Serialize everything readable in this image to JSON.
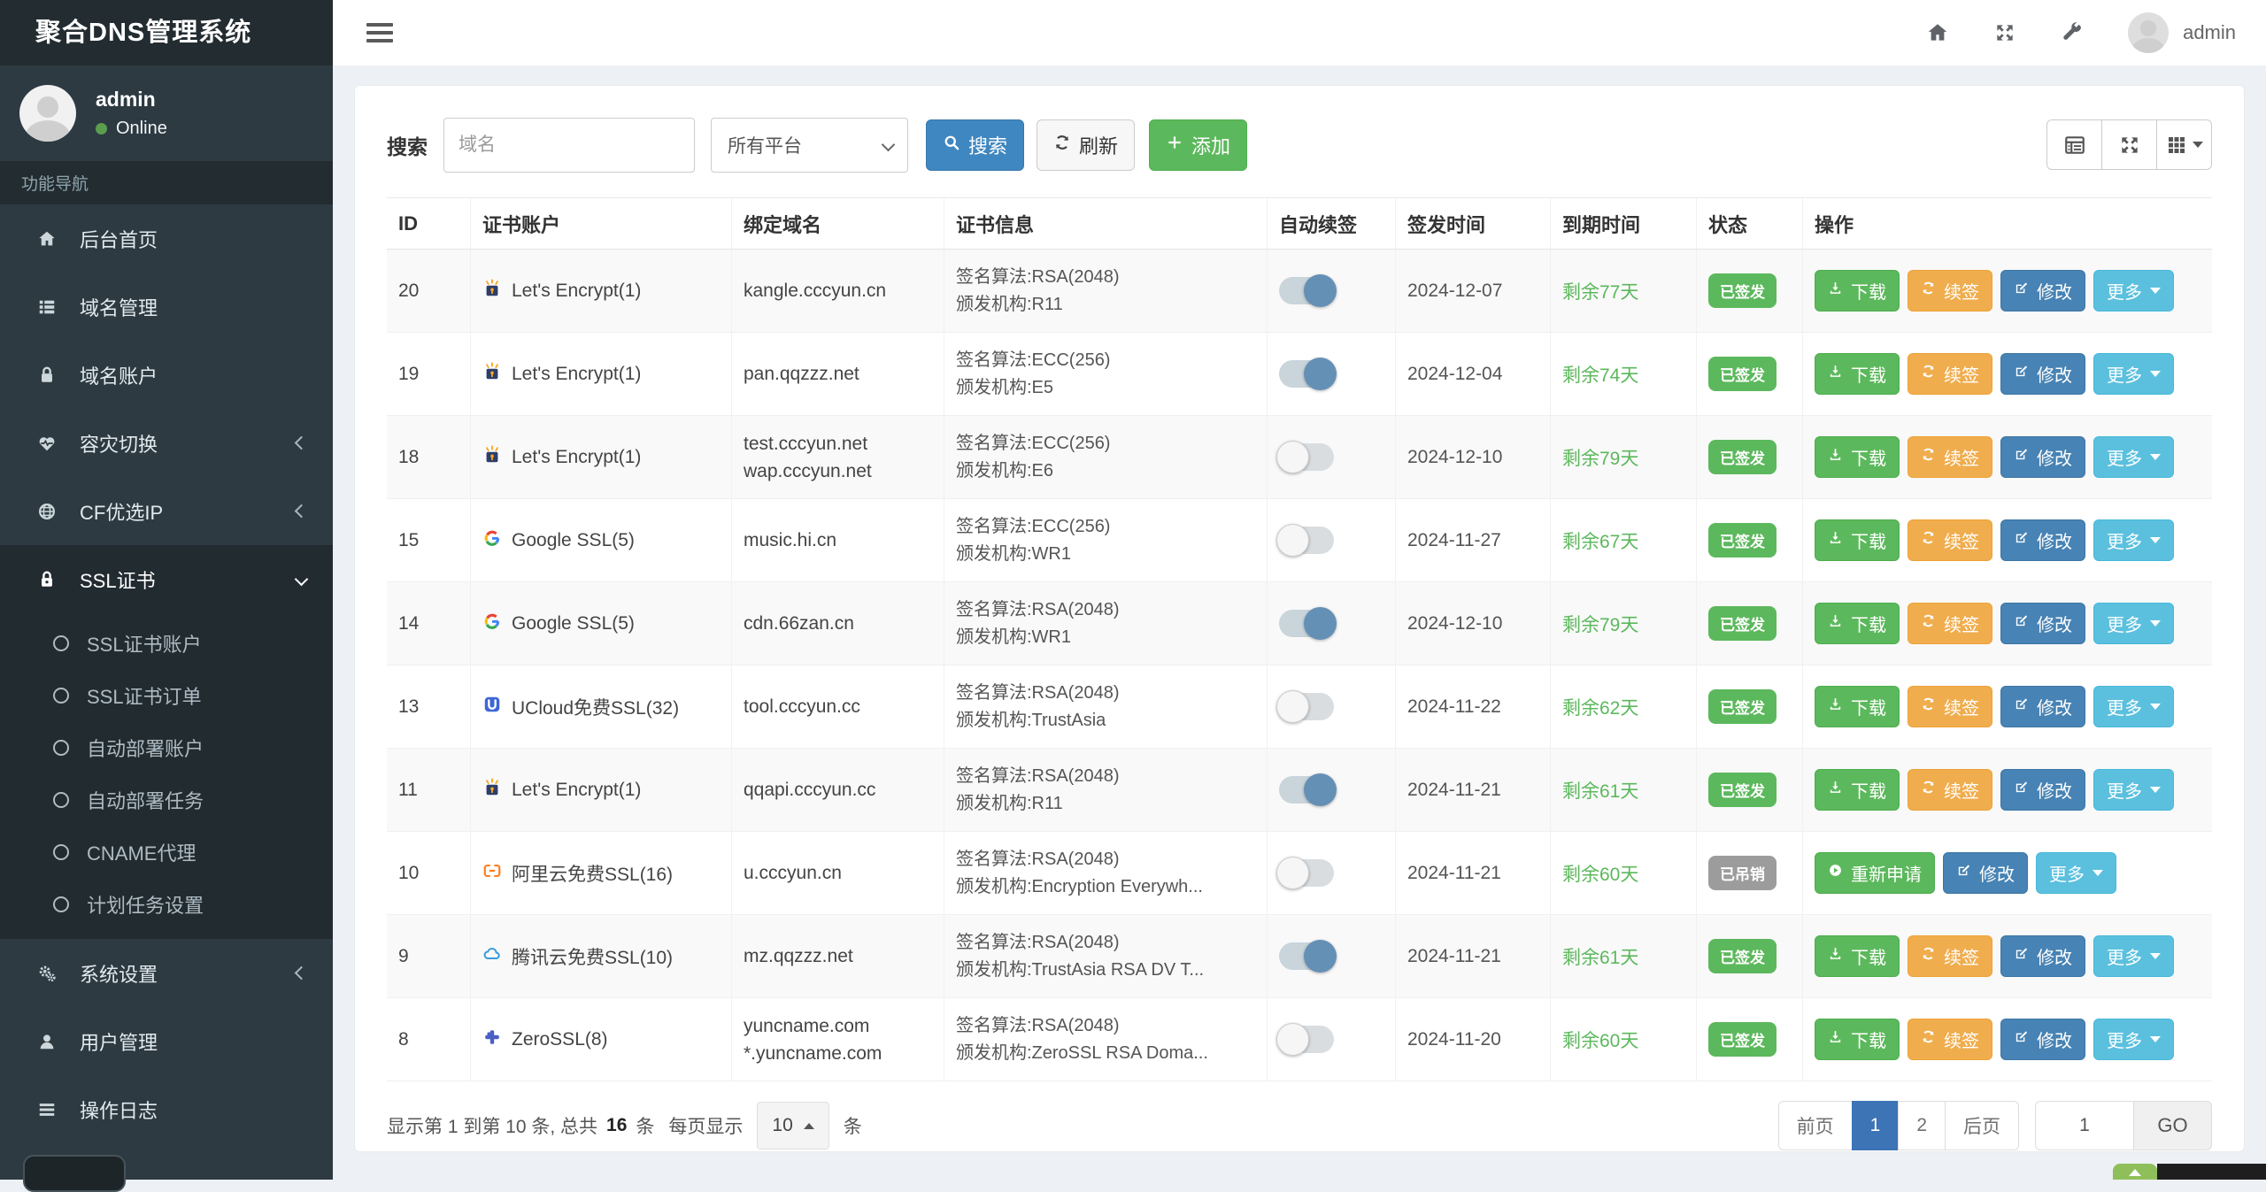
{
  "app": {
    "title": "聚合DNS管理系统"
  },
  "topbar": {
    "user": "admin",
    "icons": [
      "home-icon",
      "expand-icon",
      "wrench-icon"
    ]
  },
  "colors": {
    "primary": "#3f87c0",
    "edit_blue": "#4783b4",
    "success": "#5cb85c",
    "warning": "#f0ad4e",
    "info": "#5bc0de",
    "muted_badge": "#9c9c9c",
    "days_left_green": "#5cb85c",
    "sidebar_bg": "#2d3a42",
    "sidebar_dark": "#232c31",
    "content_bg": "#edf0f4",
    "active_page": "#3c74b5",
    "toggle_on_knob": "#6590b6"
  },
  "sidebar": {
    "user": {
      "name": "admin",
      "status": "Online"
    },
    "section_label": "功能导航",
    "items": [
      {
        "label": "后台首页",
        "icon": "home-icon"
      },
      {
        "label": "域名管理",
        "icon": "list-icon"
      },
      {
        "label": "域名账户",
        "icon": "lock-icon"
      },
      {
        "label": "容灾切换",
        "icon": "heartbeat-icon",
        "chevron": true
      },
      {
        "label": "CF优选IP",
        "icon": "globe-icon",
        "chevron": true
      },
      {
        "label": "SSL证书",
        "icon": "ssl-lock-icon",
        "active": true,
        "expanded": true,
        "children": [
          "SSL证书账户",
          "SSL证书订单",
          "自动部署账户",
          "自动部署任务",
          "CNAME代理",
          "计划任务设置"
        ]
      },
      {
        "label": "系统设置",
        "icon": "gears-icon",
        "chevron": true
      },
      {
        "label": "用户管理",
        "icon": "user-icon"
      },
      {
        "label": "操作日志",
        "icon": "log-icon"
      }
    ]
  },
  "search": {
    "label": "搜索",
    "placeholder": "域名",
    "platform_select": "所有平台",
    "search_btn": "搜索",
    "refresh_btn": "刷新",
    "add_btn": "添加",
    "toolbar_icons": [
      "table-icon",
      "fullscreen-icon",
      "columns-icon"
    ]
  },
  "table": {
    "columns": [
      "ID",
      "证书账户",
      "绑定域名",
      "证书信息",
      "自动续签",
      "签发时间",
      "到期时间",
      "状态",
      "操作"
    ],
    "action_sets": {
      "normal": [
        {
          "name": "download-button",
          "label": "下载",
          "icon": "download-icon",
          "style": "success"
        },
        {
          "name": "renew-button",
          "label": "续签",
          "icon": "refresh-icon",
          "style": "warning"
        },
        {
          "name": "edit-button",
          "label": "修改",
          "icon": "edit-icon",
          "style": "primary"
        },
        {
          "name": "more-button",
          "label": "更多",
          "icon": "caret-down-icon",
          "style": "info",
          "caret": true
        }
      ],
      "revoked": [
        {
          "name": "reapply-button",
          "label": "重新申请",
          "icon": "play-icon",
          "style": "success"
        },
        {
          "name": "edit-button",
          "label": "修改",
          "icon": "edit-icon",
          "style": "primary"
        },
        {
          "name": "more-button",
          "label": "更多",
          "icon": "caret-down-icon",
          "style": "info",
          "caret": true
        }
      ]
    },
    "rows": [
      {
        "id": "20",
        "provider": "Let's Encrypt(1)",
        "provider_icon": "letsencrypt-icon",
        "domains": [
          "kangle.cccyun.cn"
        ],
        "info": [
          "签名算法:RSA(2048)",
          "颁发机构:R11"
        ],
        "auto_renew": true,
        "issued": "2024-12-07",
        "expiry": "剩余77天",
        "status": "已签发",
        "status_type": "success",
        "actions": "normal"
      },
      {
        "id": "19",
        "provider": "Let's Encrypt(1)",
        "provider_icon": "letsencrypt-icon",
        "domains": [
          "pan.qqzzz.net"
        ],
        "info": [
          "签名算法:ECC(256)",
          "颁发机构:E5"
        ],
        "auto_renew": true,
        "issued": "2024-12-04",
        "expiry": "剩余74天",
        "status": "已签发",
        "status_type": "success",
        "actions": "normal"
      },
      {
        "id": "18",
        "provider": "Let's Encrypt(1)",
        "provider_icon": "letsencrypt-icon",
        "domains": [
          "test.cccyun.net",
          "wap.cccyun.net"
        ],
        "info": [
          "签名算法:ECC(256)",
          "颁发机构:E6"
        ],
        "auto_renew": false,
        "issued": "2024-12-10",
        "expiry": "剩余79天",
        "status": "已签发",
        "status_type": "success",
        "actions": "normal"
      },
      {
        "id": "15",
        "provider": "Google SSL(5)",
        "provider_icon": "google-icon",
        "domains": [
          "music.hi.cn"
        ],
        "info": [
          "签名算法:ECC(256)",
          "颁发机构:WR1"
        ],
        "auto_renew": false,
        "issued": "2024-11-27",
        "expiry": "剩余67天",
        "status": "已签发",
        "status_type": "success",
        "actions": "normal"
      },
      {
        "id": "14",
        "provider": "Google SSL(5)",
        "provider_icon": "google-icon",
        "domains": [
          "cdn.66zan.cn"
        ],
        "info": [
          "签名算法:RSA(2048)",
          "颁发机构:WR1"
        ],
        "auto_renew": true,
        "issued": "2024-12-10",
        "expiry": "剩余79天",
        "status": "已签发",
        "status_type": "success",
        "actions": "normal"
      },
      {
        "id": "13",
        "provider": "UCloud免费SSL(32)",
        "provider_icon": "ucloud-icon",
        "domains": [
          "tool.cccyun.cc"
        ],
        "info": [
          "签名算法:RSA(2048)",
          "颁发机构:TrustAsia"
        ],
        "auto_renew": false,
        "issued": "2024-11-22",
        "expiry": "剩余62天",
        "status": "已签发",
        "status_type": "success",
        "actions": "normal"
      },
      {
        "id": "11",
        "provider": "Let's Encrypt(1)",
        "provider_icon": "letsencrypt-icon",
        "domains": [
          "qqapi.cccyun.cc"
        ],
        "info": [
          "签名算法:RSA(2048)",
          "颁发机构:R11"
        ],
        "auto_renew": true,
        "issued": "2024-11-21",
        "expiry": "剩余61天",
        "status": "已签发",
        "status_type": "success",
        "actions": "normal"
      },
      {
        "id": "10",
        "provider": "阿里云免费SSL(16)",
        "provider_icon": "aliyun-icon",
        "domains": [
          "u.cccyun.cn"
        ],
        "info": [
          "签名算法:RSA(2048)",
          "颁发机构:Encryption Everywh..."
        ],
        "auto_renew": false,
        "issued": "2024-11-21",
        "expiry": "剩余60天",
        "status": "已吊销",
        "status_type": "muted",
        "actions": "revoked"
      },
      {
        "id": "9",
        "provider": "腾讯云免费SSL(10)",
        "provider_icon": "tencent-icon",
        "domains": [
          "mz.qqzzz.net"
        ],
        "info": [
          "签名算法:RSA(2048)",
          "颁发机构:TrustAsia RSA DV T..."
        ],
        "auto_renew": true,
        "issued": "2024-11-21",
        "expiry": "剩余61天",
        "status": "已签发",
        "status_type": "success",
        "actions": "normal"
      },
      {
        "id": "8",
        "provider": "ZeroSSL(8)",
        "provider_icon": "zerossl-icon",
        "domains": [
          "yuncname.com",
          "*.yuncname.com"
        ],
        "info": [
          "签名算法:RSA(2048)",
          "颁发机构:ZeroSSL RSA Doma..."
        ],
        "auto_renew": false,
        "issued": "2024-11-20",
        "expiry": "剩余60天",
        "status": "已签发",
        "status_type": "success",
        "actions": "normal"
      }
    ]
  },
  "pagination": {
    "info_prefix": "显示第 1 到第 10 条, 总共",
    "info_bold": "16",
    "info_after": "条",
    "per_page_label": "每页显示",
    "page_size": "10",
    "unit": "条",
    "prev": "前页",
    "pages": [
      "1",
      "2"
    ],
    "active_page": "1",
    "next": "后页",
    "goto_value": "1",
    "go_label": "GO"
  }
}
